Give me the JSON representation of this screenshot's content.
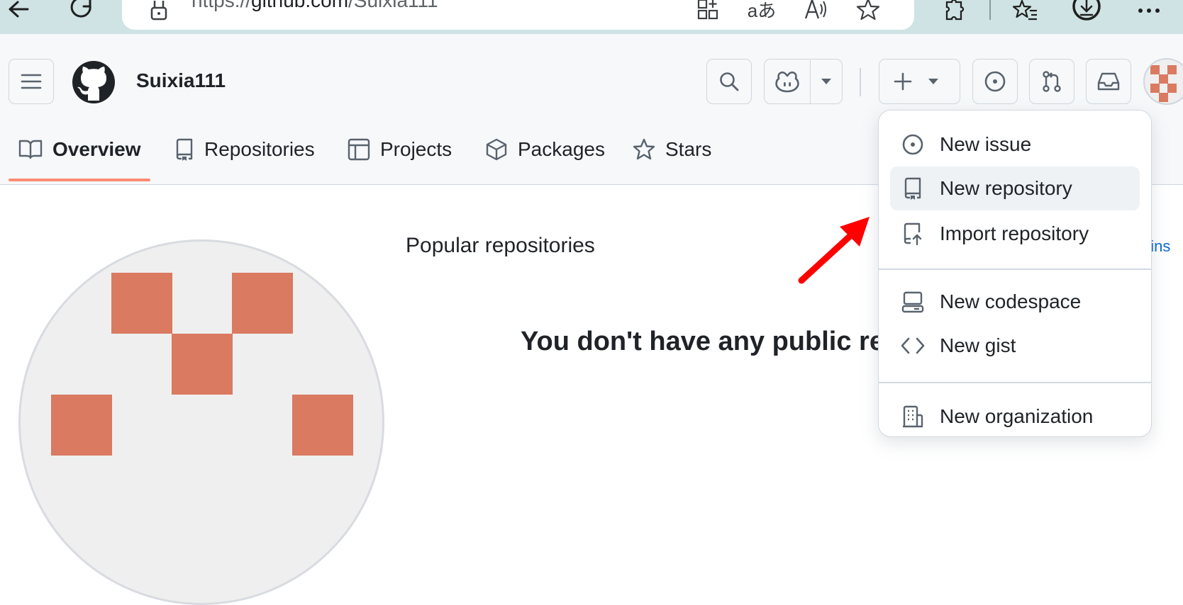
{
  "browser": {
    "url_prefix": "https://",
    "url_domain": "github.com",
    "url_path": "/Suixia111"
  },
  "header": {
    "username": "Suixia111"
  },
  "tabs": [
    {
      "label": "Overview",
      "icon": "book-icon",
      "active": true
    },
    {
      "label": "Repositories",
      "icon": "repo-icon"
    },
    {
      "label": "Projects",
      "icon": "table-icon"
    },
    {
      "label": "Packages",
      "icon": "package-icon"
    },
    {
      "label": "Stars",
      "icon": "star-icon"
    }
  ],
  "main": {
    "popular_title": "Popular repositories",
    "empty_message": "You don't have any public re",
    "pins_link": "pins"
  },
  "create_menu": {
    "items": [
      {
        "label": "New issue",
        "icon": "issue-icon"
      },
      {
        "label": "New repository",
        "icon": "repo-icon",
        "highlighted": true
      },
      {
        "label": "Import repository",
        "icon": "repo-push-icon"
      },
      {
        "label": "New codespace",
        "icon": "codespaces-icon"
      },
      {
        "label": "New gist",
        "icon": "code-icon"
      },
      {
        "label": "New organization",
        "icon": "organization-icon"
      }
    ]
  },
  "colors": {
    "accent_underline": "#fd8c73",
    "avatar": "#d97a61",
    "annotation_arrow": "#ff0000"
  }
}
